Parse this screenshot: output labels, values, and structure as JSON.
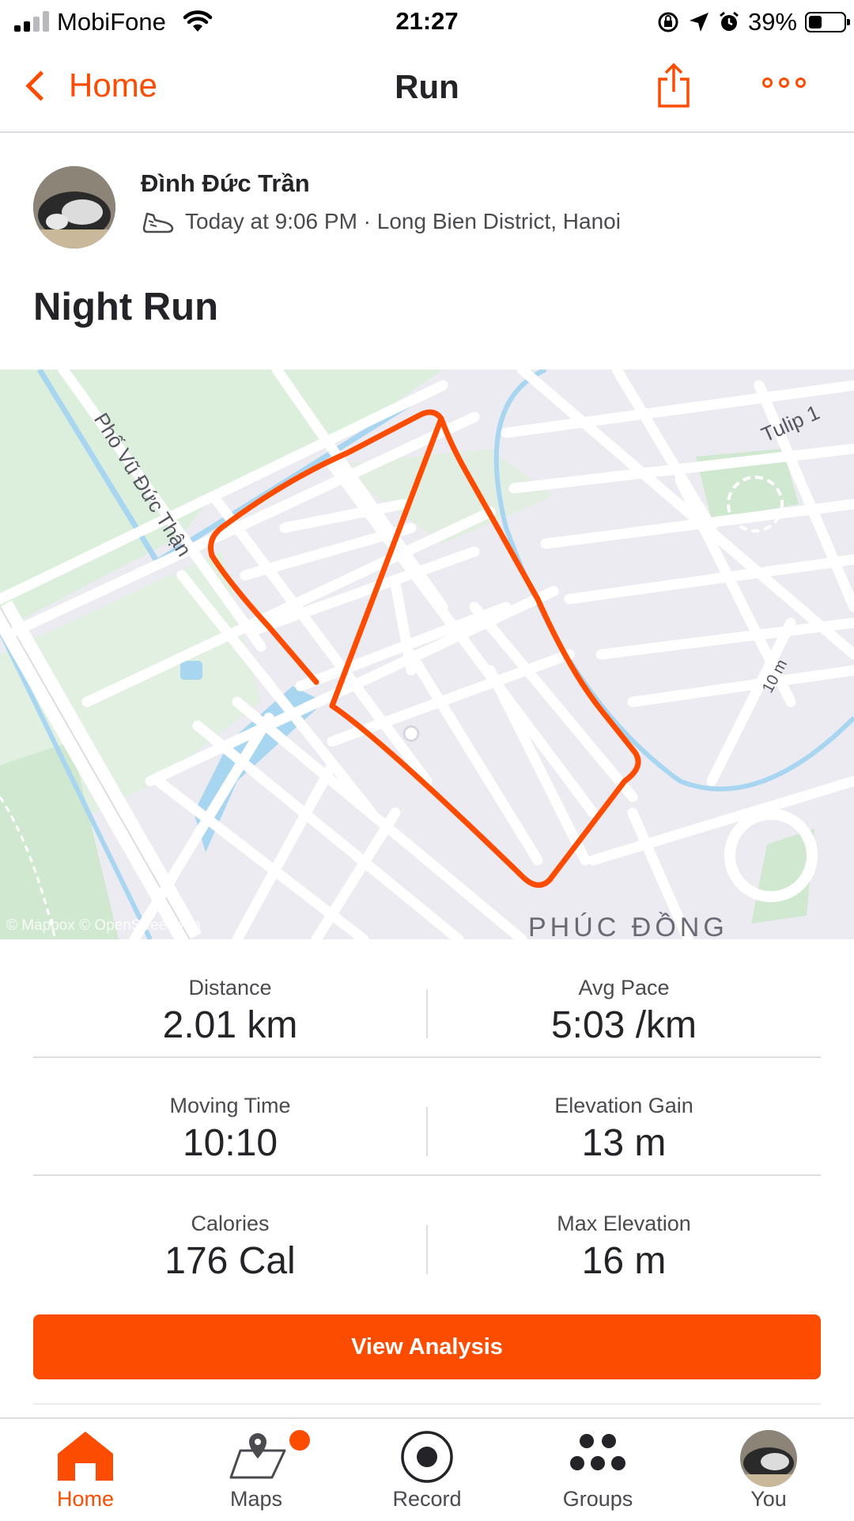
{
  "status_bar": {
    "carrier": "MobiFone",
    "time": "21:27",
    "battery": "39%"
  },
  "nav": {
    "back_label": "Home",
    "title": "Run"
  },
  "activity": {
    "athlete": "Đình Đức Trần",
    "meta": "Today at 9:06 PM · Long Bien District, Hanoi",
    "title": "Night Run",
    "map_labels": {
      "street": "Phố Vũ Đức Thận",
      "tulip": "Tulip 1",
      "district": "PHÚC ĐỒNG",
      "alley": "10 m"
    },
    "map_attribution": "© Mapbox © OpenStreetMap"
  },
  "stats": [
    {
      "label": "Distance",
      "value": "2.01 km"
    },
    {
      "label": "Avg Pace",
      "value": "5:03 /km"
    },
    {
      "label": "Moving Time",
      "value": "10:10"
    },
    {
      "label": "Elevation Gain",
      "value": "13 m"
    },
    {
      "label": "Calories",
      "value": "176 Cal"
    },
    {
      "label": "Max Elevation",
      "value": "16 m"
    }
  ],
  "analysis_button": "View Analysis",
  "tabs": [
    {
      "label": "Home",
      "icon": "home-icon"
    },
    {
      "label": "Maps",
      "icon": "maps-icon"
    },
    {
      "label": "Record",
      "icon": "record-icon"
    },
    {
      "label": "Groups",
      "icon": "groups-icon"
    },
    {
      "label": "You",
      "icon": "profile-icon"
    }
  ],
  "colors": {
    "accent": "#fc4c02",
    "route": "#fc4c02",
    "water": "#a8d6f0",
    "park": "#dcefdc",
    "map_bg": "#ecebf2"
  }
}
